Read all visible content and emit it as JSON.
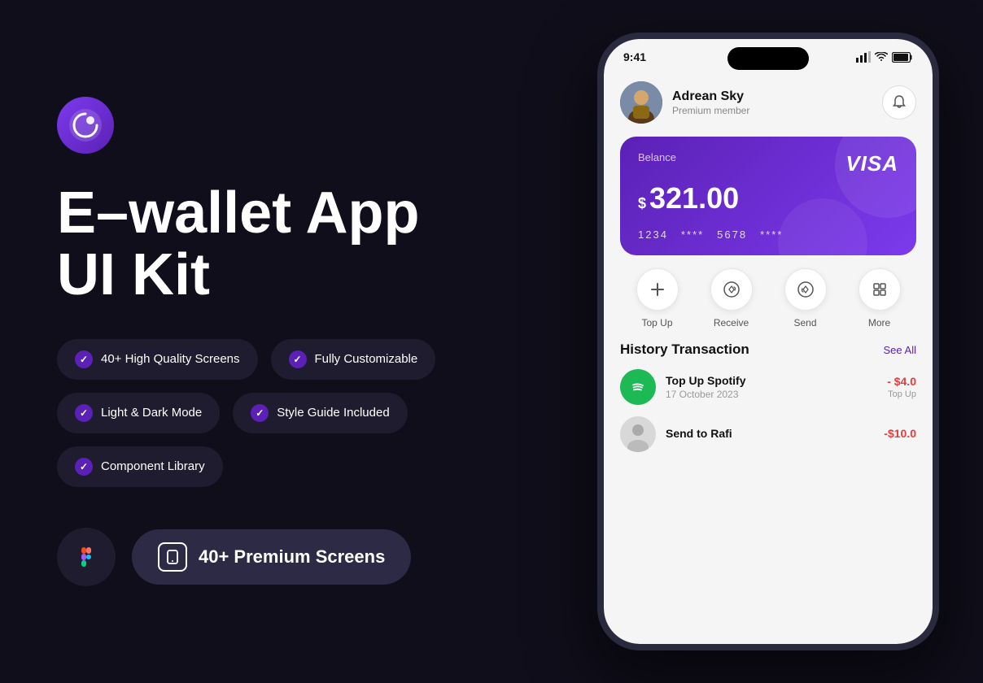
{
  "logo": {
    "alt": "brand-logo"
  },
  "left": {
    "title_line1": "E–wallet App",
    "title_line2": "UI Kit",
    "features": [
      {
        "id": "f1",
        "label": "40+ High Quality Screens"
      },
      {
        "id": "f2",
        "label": "Fully Customizable"
      },
      {
        "id": "f3",
        "label": "Light & Dark Mode"
      },
      {
        "id": "f4",
        "label": "Style Guide Included"
      },
      {
        "id": "f5",
        "label": "Component Library"
      }
    ],
    "figma_label": "Figma",
    "premium_label": "40+ Premium Screens"
  },
  "phone": {
    "status_time": "9:41",
    "user": {
      "name": "Adrean Sky",
      "role": "Premium member"
    },
    "bell": "notifications",
    "card": {
      "label": "Belance",
      "dollar": "$",
      "amount": "321.00",
      "brand": "VISA",
      "number_parts": [
        "1234",
        "****",
        "5678",
        "****"
      ]
    },
    "actions": [
      {
        "id": "top-up",
        "label": "Top Up",
        "icon": "plus"
      },
      {
        "id": "receive",
        "label": "Receive",
        "icon": "receive"
      },
      {
        "id": "send",
        "label": "Send",
        "icon": "send"
      },
      {
        "id": "more",
        "label": "More",
        "icon": "grid"
      }
    ],
    "history": {
      "title": "History Transaction",
      "see_all": "See All",
      "transactions": [
        {
          "id": "t1",
          "name": "Top Up Spotify",
          "date": "17 October 2023",
          "amount": "- $4.0",
          "type": "Top Up",
          "icon_type": "spotify"
        },
        {
          "id": "t2",
          "name": "Send to Rafi",
          "date": "",
          "amount": "-$10.0",
          "type": "",
          "icon_type": "person"
        }
      ]
    }
  },
  "colors": {
    "purple": "#7c3aed",
    "dark_purple": "#5b21b6",
    "bg": "#0f0e1a",
    "card_bg": "#1e1c2e"
  }
}
